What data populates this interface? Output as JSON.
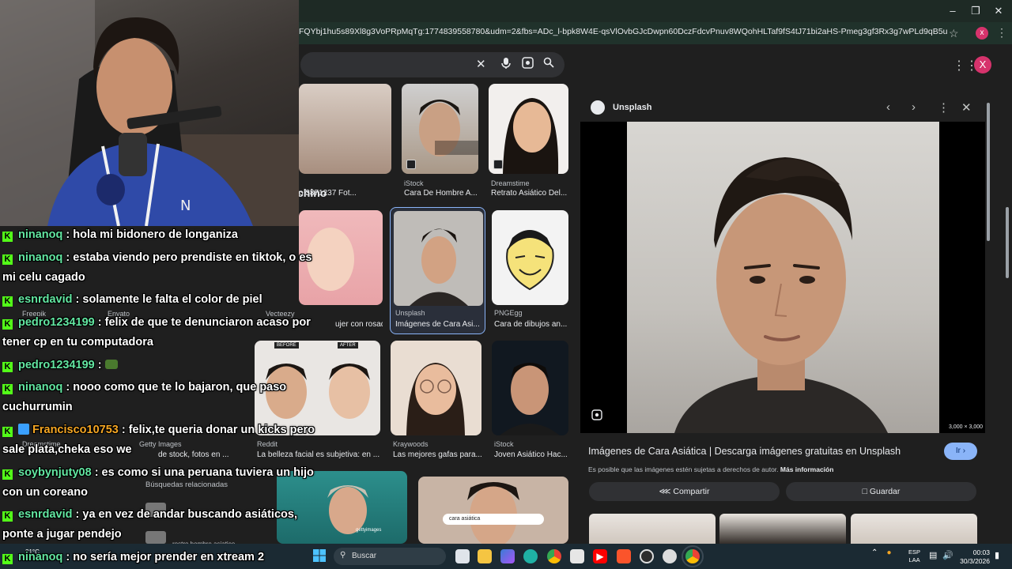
{
  "browser": {
    "url": "FQYbj1hu5s89Xl8g3VoPRpMqTg:1774839558780&udm=2&fbs=ADc_l-bpk8W4E-qsVlOvbGJcDwpn60DczFdcvPnuv8WQohHLTaf9fS4tJ71bi2aHS-Pmeg3gf3Rx3g7wPLd9qB5u5EuZYeuURw-LEmpdoZ-...",
    "profile_initial": "x",
    "account_initial": "X"
  },
  "results": {
    "partial_heading": "chino",
    "items": [
      {
        "source": "",
        "title": "o 3871237 Fot..."
      },
      {
        "source": "iStock",
        "title": "Cara De Hombre A..."
      },
      {
        "source": "Dreamstime",
        "title": "Retrato Asiático Del..."
      },
      {
        "source": "",
        "title": "ujer con rosado..."
      },
      {
        "source": "Unsplash",
        "title": "Imágenes de Cara Asi..."
      },
      {
        "source": "PNGEgg",
        "title": "Cara de dibujos an..."
      },
      {
        "source": "Reddit",
        "title": "La belleza facial es subjetiva: en ..."
      },
      {
        "source": "Kraywoods",
        "title": "Las mejores gafas para..."
      },
      {
        "source": "iStock",
        "title": "Joven Asiático Hac..."
      },
      {
        "source": "",
        "title": "de stock, fotos en ..."
      }
    ],
    "before_label": "BEFORE",
    "after_label": "AFTER",
    "related_heading": "Búsquedas relacionadas",
    "related_query": "cara asiática",
    "related_item": "rostro hombre asiatico",
    "stock_watermark": "gettyimages",
    "small_sources": [
      "Freepik",
      "Envato",
      "Vecteezy",
      "Dreamstime",
      "Getty Images"
    ]
  },
  "panel": {
    "source": "Unsplash",
    "dimensions": "3,000 × 3,000",
    "title": "Imágenes de Cara Asiática | Descarga imágenes gratuitas en Unsplash",
    "visit_label": "Ir",
    "notice": "Es posible que las imágenes estén sujetas a derechos de autor.",
    "more_info": "Más información",
    "share_label": "Compartir",
    "save_label": "Guardar"
  },
  "chat": [
    {
      "user": "ninanoq",
      "message": ": hola mi bidonero de longaniza"
    },
    {
      "user": "ninanoq",
      "message": ": estaba viendo pero prendiste en tiktok, o es mi celu cagado"
    },
    {
      "user": "esnrdavid",
      "message": ": solamente le falta el color de piel"
    },
    {
      "user": "pedro1234199",
      "message": ": felix de que te denunciaron acaso por tener cp en tu computadora"
    },
    {
      "user": "pedro1234199",
      "message": ":"
    },
    {
      "user": "ninanoq",
      "message": ": nooo como que te lo bajaron, que paso cuchurrumin"
    },
    {
      "user": "Francisco10753",
      "message": ": felix,te queria donar un kicks pero sale plata,cheka eso we"
    },
    {
      "user": "soybynjuty08",
      "message": ": es como si una peruana tuviera un hijo con un coreano"
    },
    {
      "user": "esnrdavid",
      "message": ": ya en vez de andar buscando asiáticos, ponte a jugar pendejo"
    },
    {
      "user": "ninanoq",
      "message": ": no sería mejor prender en xtream 2"
    }
  ],
  "taskbar": {
    "weather": "21°C",
    "search_label": "Buscar",
    "lang_top": "ESP",
    "lang_bottom": "LAA",
    "time": "00:03",
    "date": "30/3/2026"
  },
  "colors": {
    "kick_green": "#53fc18",
    "accent_blue": "#8ab4f8",
    "username_green": "#62e6a1",
    "username_orange": "#f5a623"
  }
}
